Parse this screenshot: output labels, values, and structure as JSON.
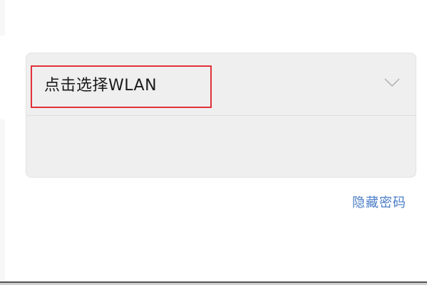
{
  "wlan": {
    "select_label": "点击选择WLAN"
  },
  "password": {
    "value": ""
  },
  "links": {
    "hide_password": "隐藏密码"
  },
  "colors": {
    "highlight": "#e0313a",
    "link": "#4a7cc7",
    "card_background": "#efefef"
  },
  "icons": {
    "dropdown": "chevron-down-icon"
  }
}
